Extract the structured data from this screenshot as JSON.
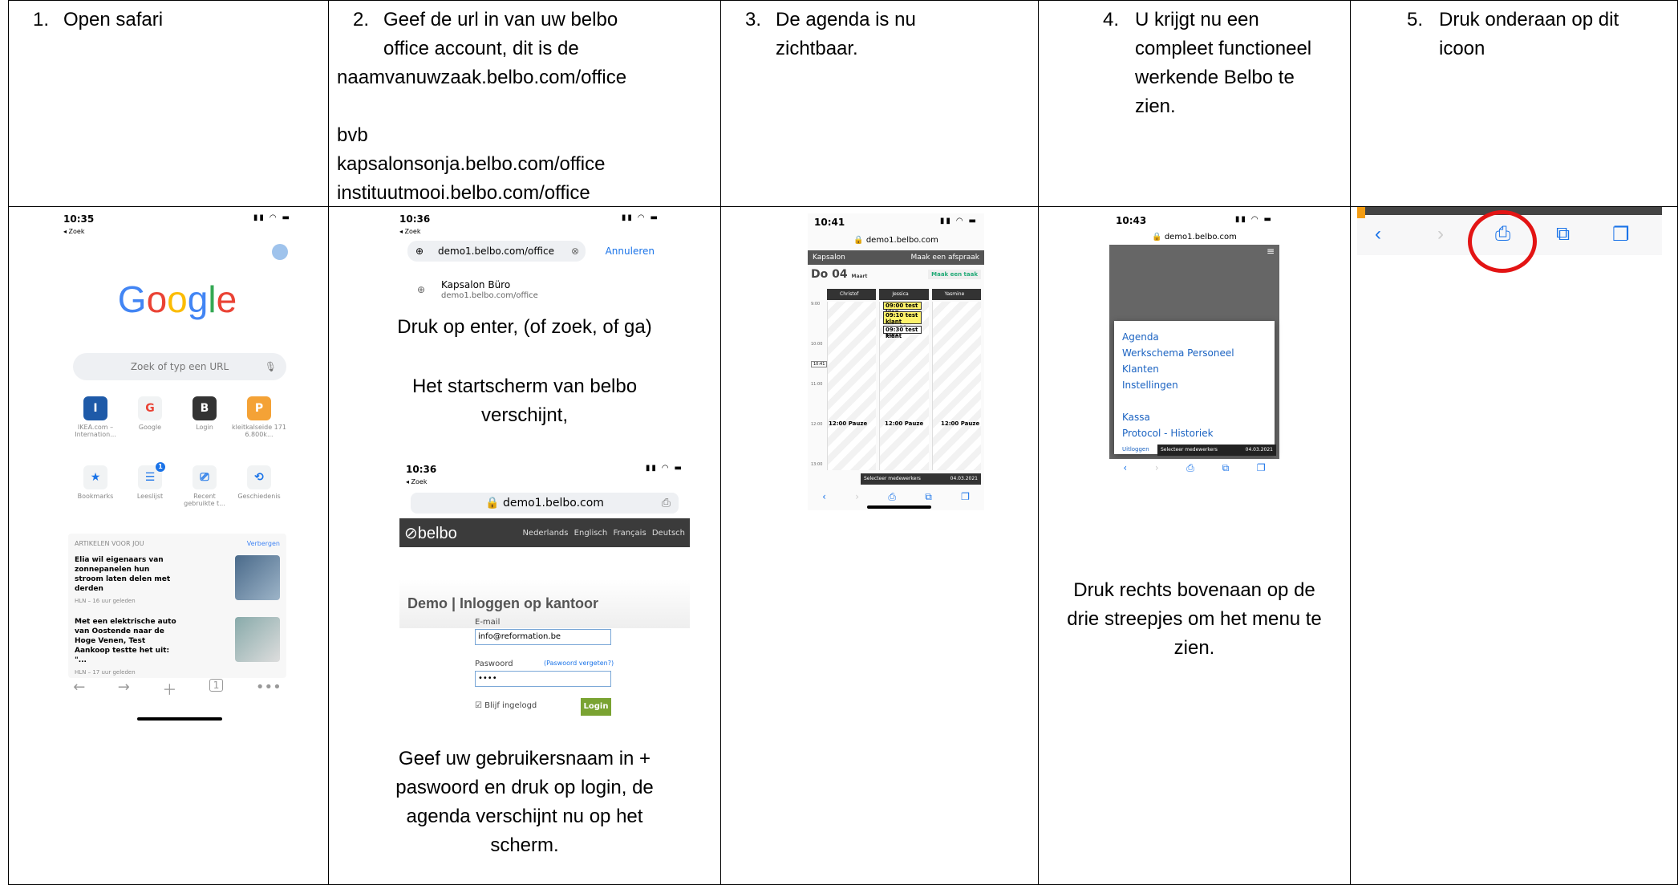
{
  "steps": [
    {
      "number": "1.",
      "lines": [
        "Open safari"
      ]
    },
    {
      "number": "2.",
      "lines": [
        "Geef de url in van uw belbo",
        "office account, dit is de",
        "naamvanuwzaak.belbo.com/office",
        "",
        "bvb",
        "kapsalonsonja.belbo.com/office",
        "instituutmooi.belbo.com/office"
      ]
    },
    {
      "number": "3.",
      "lines": [
        "De agenda is nu",
        "zichtbaar."
      ]
    },
    {
      "number": "4.",
      "lines": [
        "U krijgt nu een",
        "compleet functioneel",
        "werkende Belbo te",
        "zien."
      ]
    },
    {
      "number": "5.",
      "lines": [
        "Druk onderaan op dit",
        "icoon"
      ]
    }
  ],
  "col2_captions": {
    "enter": "Druk op enter, (of zoek, of ga)",
    "startscherm": "Het startscherm van belbo verschijnt,",
    "login": "Geef uw gebruikersnaam in + paswoord en druk op login, de agenda verschijnt nu op het scherm."
  },
  "col4_caption": "Druk rechts bovenaan op de drie streepjes om het menu te zien.",
  "phone1": {
    "time": "10:35",
    "back": "◂ Zoek",
    "logo": [
      "G",
      "o",
      "o",
      "g",
      "l",
      "e"
    ],
    "search_placeholder": "Zoek of typ een URL",
    "shortcuts_row1": [
      {
        "glyph": "I",
        "label": "IKEA.com – Internation...",
        "color": "#1e5aa8"
      },
      {
        "glyph": "G",
        "label": "Google",
        "color": "#ea4335"
      },
      {
        "glyph": "B",
        "label": "Login",
        "color": "#333333"
      },
      {
        "glyph": "P",
        "label": "kleitkalseide 171 6.800k...",
        "color": "#f4a236"
      }
    ],
    "shortcuts_row2": [
      {
        "glyph": "★",
        "label": "Bookmarks",
        "color": "#1a73e8"
      },
      {
        "glyph": "☰",
        "label": "Leeslijst",
        "color": "#1a73e8"
      },
      {
        "glyph": "⎚",
        "label": "Recent gebruikte t...",
        "color": "#1a73e8"
      },
      {
        "glyph": "⟲",
        "label": "Geschiedenis",
        "color": "#1a73e8"
      }
    ],
    "articles_title": "ARTIKELEN VOOR JOU",
    "articles_hide": "Verbergen",
    "articles": [
      {
        "title": "Elia wil eigenaars van zonnepanelen hun stroom laten delen met derden",
        "source": "HLN – 16 uur geleden"
      },
      {
        "title": "Met een elektrische auto van Oostende naar de Hoge Venen, Test Aankoop testte het uit: \"...",
        "source": "HLN – 17 uur geleden"
      }
    ],
    "tab_count": "1"
  },
  "phone2": {
    "time": "10:36",
    "back": "◂ Zoek",
    "url": "demo1.belbo.com/office",
    "cancel": "Annuleren",
    "suggestion_title": "Kapsalon Büro",
    "suggestion_url": "demo1.belbo.com/office"
  },
  "phone2b": {
    "time": "10:36",
    "back": "◂ Zoek",
    "url": "demo1.belbo.com",
    "logo": "belbo",
    "languages": "Nederlands Englisch Français Deutsch",
    "title": "Demo | Inloggen op kantoor",
    "email_label": "E-mail",
    "email_value": "info@reformation.be",
    "password_label": "Paswoord",
    "password_forgot": "(Paswoord vergeten?)",
    "password_value": "••••",
    "remember": "Blijf ingelogd",
    "login_button": "Login"
  },
  "phone3": {
    "time": "10:41",
    "url": "demo1.belbo.com",
    "salon": "Kapsalon",
    "new_appt": "Maak een afspraak",
    "day": "Do 04",
    "month": "Maart",
    "new_task": "Maak een taak",
    "staff": [
      "Christof",
      "Jessica",
      "Yasmine"
    ],
    "appointments": [
      "09:00 test klan",
      "09:10 test klant Brushing kort",
      "09:30 test klant"
    ],
    "pauze": "12:00 Pauze",
    "hours": [
      "9:00",
      "10:00",
      "11:00",
      "12:00",
      "13:00"
    ],
    "now": "10:41",
    "select_staff": "Selecteer medewerkers",
    "date": "04.03.2021"
  },
  "phone4": {
    "time": "10:43",
    "url": "demo1.belbo.com",
    "menu_items": [
      "Agenda",
      "Werkschema Personeel",
      "Klanten",
      "Instellingen"
    ],
    "menu_items2": [
      "Kassa",
      "Protocol - Historiek"
    ],
    "logout": "Uitloggen",
    "select_staff": "Selecteer medewerkers",
    "date": "04.03.2021"
  }
}
